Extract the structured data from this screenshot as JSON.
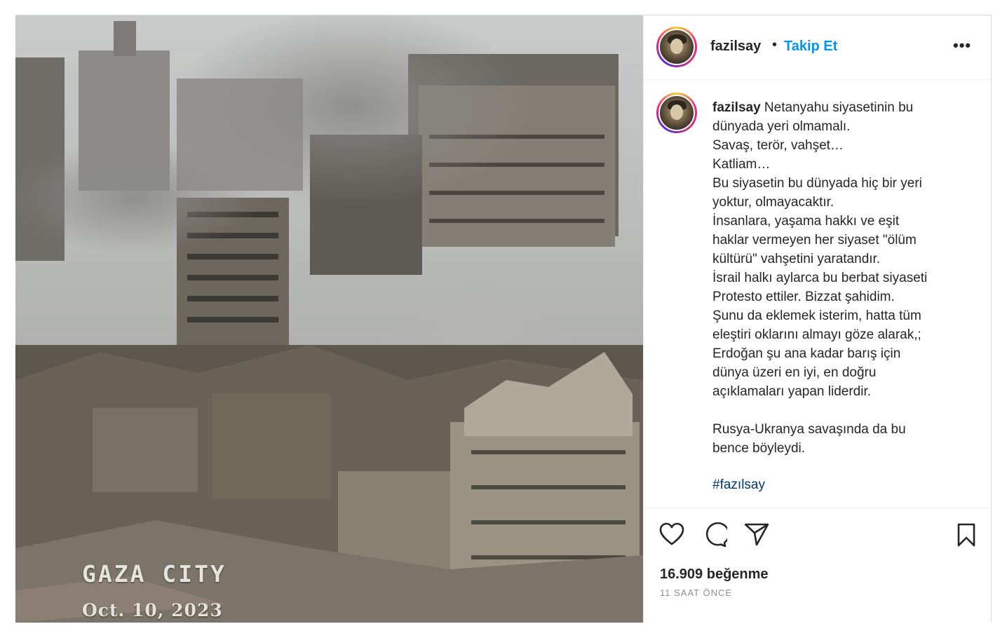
{
  "post": {
    "username": "fazilsay",
    "separator": "•",
    "follow_label": "Takip Et",
    "more_label": "•••",
    "image": {
      "caption_place": "GAZA CITY",
      "caption_date": "Oct. 10, 2023"
    },
    "comment": {
      "username": "fazilsay",
      "text": " Netanyahu siyasetinin bu\ndünyada yeri olmamalı.\nSavaş, terör, vahşet…\nKatliam…\nBu siyasetin bu dünyada hiç bir yeri\nyoktur, olmayacaktır.\nİnsanlara, yaşama hakkı ve eşit\nhaklar vermeyen her siyaset \"ölüm\nkültürü\" vahşetini yaratandır.\nİsrail halkı aylarca bu berbat siyaseti\nProtesto ettiler. Bizzat şahidim.\nŞunu da eklemek isterim, hatta tüm\neleştiri oklarını almayı göze alarak,;\nErdoğan şu ana kadar barış için\ndünya üzeri en iyi, en doğru\naçıklamaları yapan liderdir.\n\nRusya-Ukranya savaşında da bu\nbence böyleydi.",
      "hashtag": "#fazılsay"
    },
    "likes": "16.909 beğenme",
    "time": "11 SAAT ÖNCE",
    "icons": [
      "heart-icon",
      "comment-icon",
      "share-icon",
      "bookmark-icon"
    ]
  }
}
